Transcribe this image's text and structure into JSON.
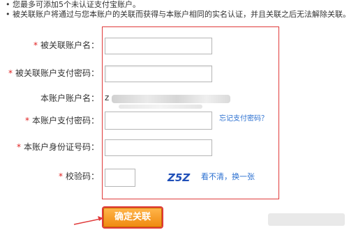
{
  "notices": [
    {
      "bullet": "•",
      "text": "您最多可添加5个未认证支付宝账户。"
    },
    {
      "bullet": "•",
      "text": "被关联账户将通过与您本账户的关联而获得与本账户相同的实名认证，并且关联之后无法解除关联。"
    }
  ],
  "form": {
    "linked_account_label": "被关联账户名：",
    "linked_pay_password_label": "被关联账户支付密码：",
    "this_account_label": "本账户账户名：",
    "this_account_value": "z",
    "this_pay_password_label": "本账户支付密码：",
    "forgot_password_link": "忘记支付密码？",
    "id_number_label": "本账户身份证号码：",
    "captcha_label": "校验码：",
    "captcha_text": "Z5Z",
    "refresh_link": "看不清，换一张",
    "required_mark": "*",
    "linked_account_value": "",
    "linked_pay_password_value": "",
    "this_pay_password_value": "",
    "id_number_value": "",
    "captcha_value": ""
  },
  "actions": {
    "confirm_label": "确定关联"
  },
  "colors": {
    "required": "#e02020",
    "highlight_border": "#e03a3a",
    "link": "#2a6fd0",
    "button": "#f08a10"
  }
}
